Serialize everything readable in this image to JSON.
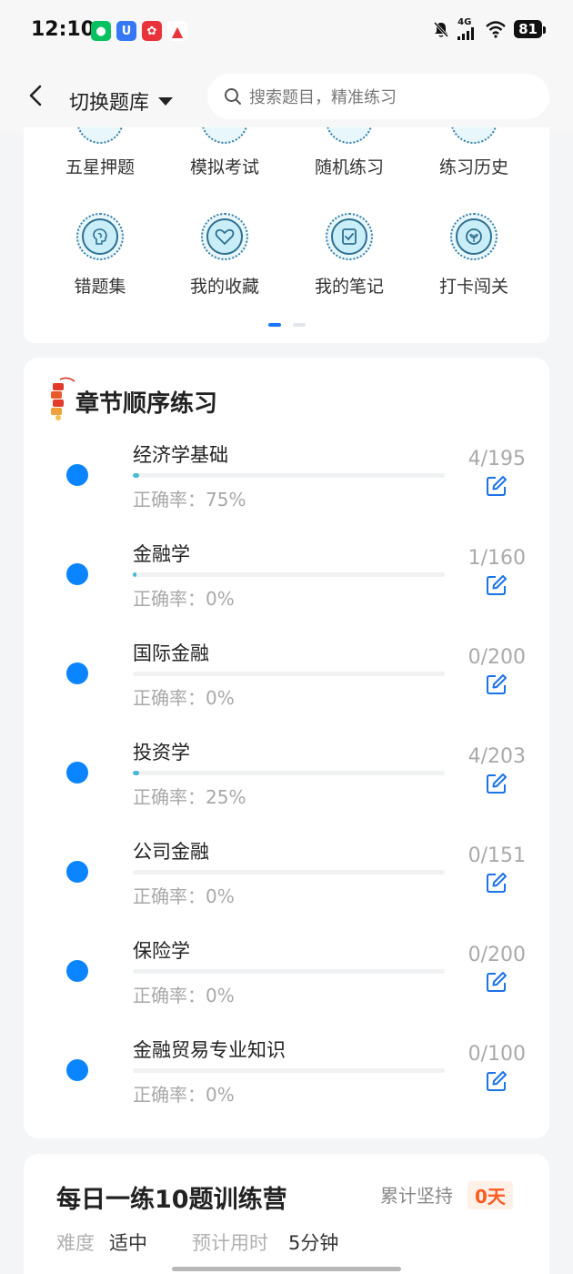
{
  "status_bar": {
    "time": "12:10",
    "network": "4G",
    "battery": "81"
  },
  "header": {
    "switch_label": "切换题库",
    "search_placeholder": "搜索题目，精准练习"
  },
  "features": [
    {
      "label": "五星押题",
      "icon": "star-icon"
    },
    {
      "label": "模拟考试",
      "icon": "exam-icon"
    },
    {
      "label": "随机练习",
      "icon": "shuffle-icon"
    },
    {
      "label": "练习历史",
      "icon": "history-icon"
    },
    {
      "label": "错题集",
      "icon": "brain-icon"
    },
    {
      "label": "我的收藏",
      "icon": "heart-icon"
    },
    {
      "label": "我的笔记",
      "icon": "note-icon"
    },
    {
      "label": "打卡闯关",
      "icon": "leaf-icon"
    }
  ],
  "chapter": {
    "title": "章节顺序练习",
    "accuracy_prefix": "正确率：",
    "rows": [
      {
        "name": "经济学基础",
        "accuracy": "75%",
        "count": "4/195",
        "progress": 0.021
      },
      {
        "name": "金融学",
        "accuracy": "0%",
        "count": "1/160",
        "progress": 0.006
      },
      {
        "name": "国际金融",
        "accuracy": "0%",
        "count": "0/200",
        "progress": 0
      },
      {
        "name": "投资学",
        "accuracy": "25%",
        "count": "4/203",
        "progress": 0.02
      },
      {
        "name": "公司金融",
        "accuracy": "0%",
        "count": "0/151",
        "progress": 0
      },
      {
        "name": "保险学",
        "accuracy": "0%",
        "count": "0/200",
        "progress": 0
      },
      {
        "name": "金融贸易专业知识",
        "accuracy": "0%",
        "count": "0/100",
        "progress": 0
      }
    ]
  },
  "daily": {
    "title": "每日一练10题训练营",
    "persist_label": "累计坚持",
    "persist_value": "0天",
    "difficulty_label": "难度",
    "difficulty_value": "适中",
    "time_label": "预计用时",
    "time_value": "5分钟"
  },
  "colors": {
    "accent": "#0a84ff",
    "progress": "#48b9d6",
    "badge": "#ff5a1f"
  }
}
